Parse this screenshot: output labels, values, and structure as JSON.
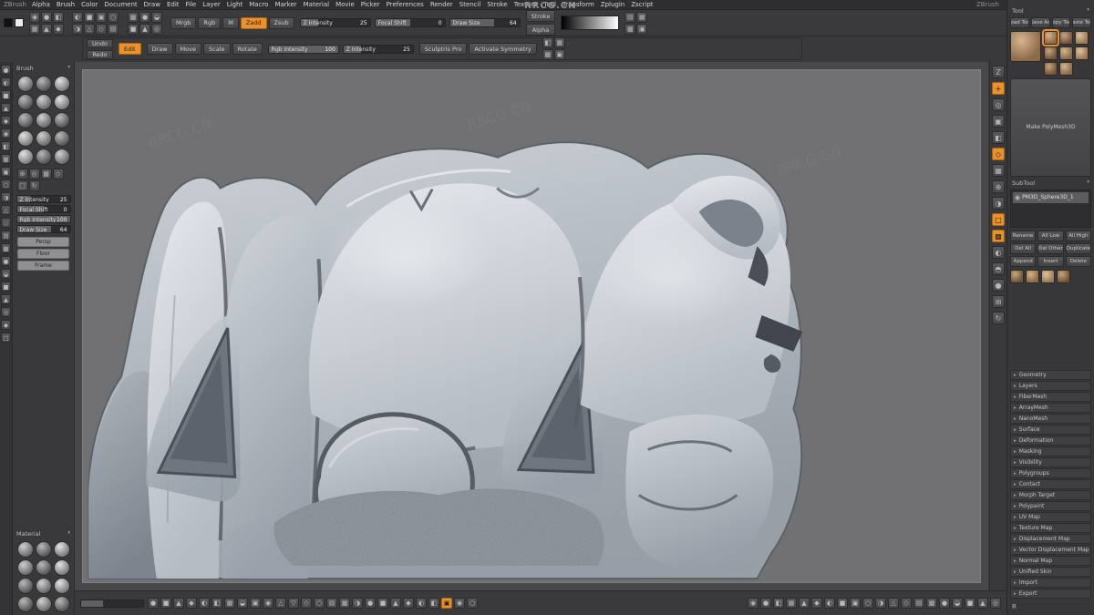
{
  "app": {
    "title": "ZBrush",
    "watermark": "RRCG.CN"
  },
  "colors": {
    "accent": "#e8922f",
    "canvas": "#717173",
    "model_light": "#e6e9ed"
  },
  "ui": {
    "section_arrow": "▸",
    "collapse_arrow": "▾",
    "eye_icon": "◉",
    "menu_icon": "≡"
  },
  "menubar": {
    "items": [
      "Alpha",
      "Brush",
      "Color",
      "Document",
      "Draw",
      "Edit",
      "File",
      "Layer",
      "Light",
      "Macro",
      "Marker",
      "Material",
      "Movie",
      "Picker",
      "Preferences",
      "Render",
      "Stencil",
      "Stroke",
      "Texture",
      "Tool",
      "Transform",
      "Zplugin",
      "Zscript"
    ],
    "right_text": "ZBrush"
  },
  "top_shelf": {
    "swatches": [
      {
        "name": "main-color-swatch",
        "tone": 9
      },
      {
        "name": "secondary-color-swatch",
        "tone": 0
      }
    ],
    "cluster1": [
      "◉",
      "●",
      "◧",
      "▦",
      "▲",
      "◆"
    ],
    "cluster2": [
      "◐",
      "■",
      "▣",
      "○",
      "◑",
      "△",
      "◇",
      "▤"
    ],
    "cluster3": [
      "▩",
      "●",
      "◒",
      "■",
      "▲",
      "◎"
    ],
    "cluster4": [
      "▤",
      "▦",
      "▩",
      "▣"
    ],
    "mode_buttons": [
      {
        "label": "Mrgb"
      },
      {
        "label": "Rgb"
      },
      {
        "label": "M"
      },
      {
        "label": "Zadd",
        "active": true
      },
      {
        "label": "Zsub"
      }
    ],
    "sliders": [
      {
        "label": "Z Intensity",
        "value": "25",
        "fill": 25
      },
      {
        "label": "Focal Shift",
        "value": "0",
        "fill": 50
      },
      {
        "label": "Draw Size",
        "value": "64",
        "fill": 64
      }
    ],
    "dropdowns": [
      {
        "label": "Stroke"
      },
      {
        "label": "Alpha"
      }
    ],
    "row2": {
      "history_buttons": [
        {
          "label": "Undo"
        },
        {
          "label": "Redo"
        }
      ],
      "edit_button": {
        "label": "Edit"
      },
      "transform_buttons": [
        {
          "label": "Draw"
        },
        {
          "label": "Move"
        },
        {
          "label": "Scale"
        },
        {
          "label": "Rotate"
        }
      ],
      "sliders": [
        {
          "label": "Rgb Intensity",
          "value": "100",
          "fill": 100
        },
        {
          "label": "Z Intensity",
          "value": "25",
          "fill": 25
        }
      ],
      "feature_buttons": [
        {
          "label": "Sculptris Pro"
        },
        {
          "label": "Activate Symmetry"
        }
      ],
      "cluster": [
        "◧",
        "▦",
        "▩",
        "▣"
      ]
    }
  },
  "left_strip": {
    "icons": [
      "●",
      "◐",
      "■",
      "▲",
      "◆",
      "◉",
      "◧",
      "▦",
      "▣",
      "○",
      "◑",
      "△",
      "◇",
      "▤",
      "▩",
      "●",
      "◒",
      "■",
      "▲",
      "◎",
      "◆",
      "□"
    ]
  },
  "left_tray": {
    "brush_header": "Brush",
    "brush_thumbs": [
      {
        "tone": 1
      },
      {
        "tone": 2
      },
      {
        "tone": 3
      },
      {
        "tone": 2
      },
      {
        "tone": 1
      },
      {
        "tone": 3
      },
      {
        "tone": 2
      },
      {
        "tone": 1
      },
      {
        "tone": 2
      },
      {
        "tone": 3
      },
      {
        "tone": 1
      },
      {
        "tone": 2
      },
      {
        "tone": 3
      },
      {
        "tone": 2
      },
      {
        "tone": 1
      }
    ],
    "tool_icons": [
      "⊕",
      "◎",
      "▦",
      "◇",
      "□",
      "↻"
    ],
    "sliders": [
      {
        "label": "Z Intensity",
        "value": "25",
        "fill": 25
      },
      {
        "label": "Focal Shift",
        "value": "0",
        "fill": 50
      },
      {
        "label": "Rgb Intensity",
        "value": "100",
        "fill": 100
      },
      {
        "label": "Draw Size",
        "value": "64",
        "fill": 64
      }
    ],
    "buttons": [
      {
        "label": "Persp"
      },
      {
        "label": "Floor"
      },
      {
        "label": "Frame"
      }
    ],
    "material_header": "Material",
    "material_thumbs": [
      {
        "tone": 1
      },
      {
        "tone": 2
      },
      {
        "tone": 3
      },
      {
        "tone": 1
      },
      {
        "tone": 2
      },
      {
        "tone": 3
      },
      {
        "tone": 2
      },
      {
        "tone": 1
      },
      {
        "tone": 3
      },
      {
        "tone": 2
      },
      {
        "tone": 1
      },
      {
        "tone": 2
      }
    ]
  },
  "canvas": {
    "watermark_diag": "RRCG.CN"
  },
  "right_shelf": {
    "icons": [
      {
        "name": "zbrush-logo-icon",
        "glyph": "Z"
      },
      {
        "name": "scroll-doc-icon",
        "glyph": "+",
        "active": true
      },
      {
        "name": "zoom-doc-icon",
        "glyph": "◎"
      },
      {
        "name": "actual-size-icon",
        "glyph": "▣"
      },
      {
        "name": "aa-half-icon",
        "glyph": "◧"
      },
      {
        "name": "persp-icon",
        "glyph": "◇",
        "active": true
      },
      {
        "name": "floor-icon",
        "glyph": "▦"
      },
      {
        "name": "local-transform-icon",
        "glyph": "⊕"
      },
      {
        "name": "lsym-icon",
        "glyph": "◑"
      },
      {
        "name": "frame-icon",
        "glyph": "□",
        "active": true
      },
      {
        "name": "polyframe-icon",
        "glyph": "▩",
        "active": true
      },
      {
        "name": "transparency-icon",
        "glyph": "◐"
      },
      {
        "name": "ghost-icon",
        "glyph": "◓"
      },
      {
        "name": "solo-icon",
        "glyph": "●"
      },
      {
        "name": "xpose-icon",
        "glyph": "⊞"
      },
      {
        "name": "rotate-doc-icon",
        "glyph": "↻"
      }
    ]
  },
  "right_tray": {
    "header": "Tool",
    "top_buttons": [
      {
        "label": "Load Tool"
      },
      {
        "label": "Save As"
      },
      {
        "label": "Copy Tool"
      },
      {
        "label": "Paste Tool"
      }
    ],
    "recent_thumbs": [
      {
        "tone": 4,
        "active": true
      },
      {
        "tone": 5
      },
      {
        "tone": 6
      },
      {
        "tone": 5
      },
      {
        "tone": 4
      },
      {
        "tone": 6
      },
      {
        "tone": 5
      },
      {
        "tone": 4
      }
    ],
    "make_poly": {
      "label": "Make PolyMesh3D"
    },
    "subtool_header": "SubTool",
    "subtool_rows": [
      {
        "label": "PM3D_Sphere3D_1",
        "active": true
      }
    ],
    "subtool_buttons": [
      {
        "label": "Rename"
      },
      {
        "label": "All Low"
      },
      {
        "label": "All High"
      },
      {
        "label": "Del All"
      },
      {
        "label": "Del Other"
      },
      {
        "label": "Duplicate"
      },
      {
        "label": "Append"
      },
      {
        "label": "Insert"
      },
      {
        "label": "Delete"
      }
    ],
    "mid_thumbs": [
      {
        "tone": 5
      },
      {
        "tone": 4
      },
      {
        "tone": 6
      },
      {
        "tone": 5
      }
    ],
    "sections": [
      {
        "label": "Geometry"
      },
      {
        "label": "Layers"
      },
      {
        "label": "FiberMesh"
      },
      {
        "label": "ArrayMesh"
      },
      {
        "label": "NanoMesh"
      },
      {
        "label": "Surface"
      },
      {
        "label": "Deformation"
      },
      {
        "label": "Masking"
      },
      {
        "label": "Visibility"
      },
      {
        "label": "Polygroups"
      },
      {
        "label": "Contact"
      },
      {
        "label": "Morph Target"
      },
      {
        "label": "Polypaint"
      },
      {
        "label": "UV Map"
      },
      {
        "label": "Texture Map"
      },
      {
        "label": "Displacement Map"
      },
      {
        "label": "Vector Displacement Map"
      },
      {
        "label": "Normal Map"
      },
      {
        "label": "Unified Skin"
      },
      {
        "label": "Import"
      },
      {
        "label": "Export"
      }
    ],
    "footer": {
      "label": "R"
    }
  },
  "bottom_shelf": {
    "icons_left": [
      "●",
      "■",
      "▲",
      "◆",
      "◐",
      "◧",
      "▦",
      "◒",
      "▣",
      "◉",
      "△",
      "▽",
      "◇",
      "○",
      "▤",
      "▩",
      "◑",
      "●",
      "■",
      "▲",
      "◆",
      "◐",
      "◧",
      {
        "glyph": "▣",
        "active": true
      },
      "◉",
      "○"
    ],
    "icons_right": [
      "◉",
      "●",
      "◧",
      "▦",
      "▲",
      "◆",
      "◐",
      "■",
      "▣",
      "○",
      "◑",
      "△",
      "◇",
      "▤",
      "▩",
      "●",
      "◒",
      "■",
      "▲",
      "◎"
    ]
  }
}
